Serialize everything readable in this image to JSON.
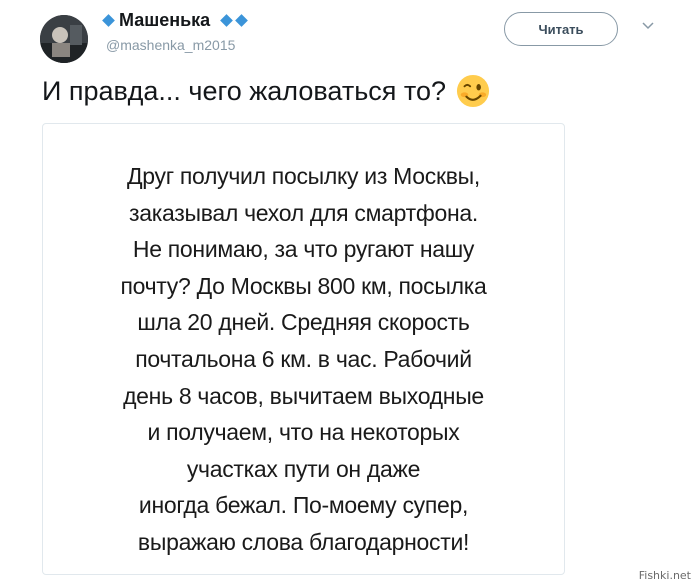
{
  "header": {
    "display_name": "Машенька",
    "handle": "@mashenka_m2015",
    "follow_label": "Читать"
  },
  "tweet": {
    "text": "И правда... чего жаловаться то?",
    "emoji": "winking-face"
  },
  "media": {
    "lines": [
      "Друг получил посылку из Москвы,",
      "заказывал чехол для смартфона.",
      "Не понимаю, за что ругают нашу",
      "почту? До Москвы 800 км, посылка",
      "шла 20 дней. Средняя скорость",
      "почтальона 6 км. в час. Рабочий",
      "день 8 часов, вычитаем выходные",
      "и получаем, что на некоторых",
      "участках пути он даже",
      "иногда бежал. По-моему супер,",
      "выражаю слова благодарности!"
    ]
  },
  "watermark": "Fishki.net",
  "colors": {
    "diamond": "#3b94d9",
    "handle": "#8899a6",
    "border": "#e1e8ed"
  }
}
